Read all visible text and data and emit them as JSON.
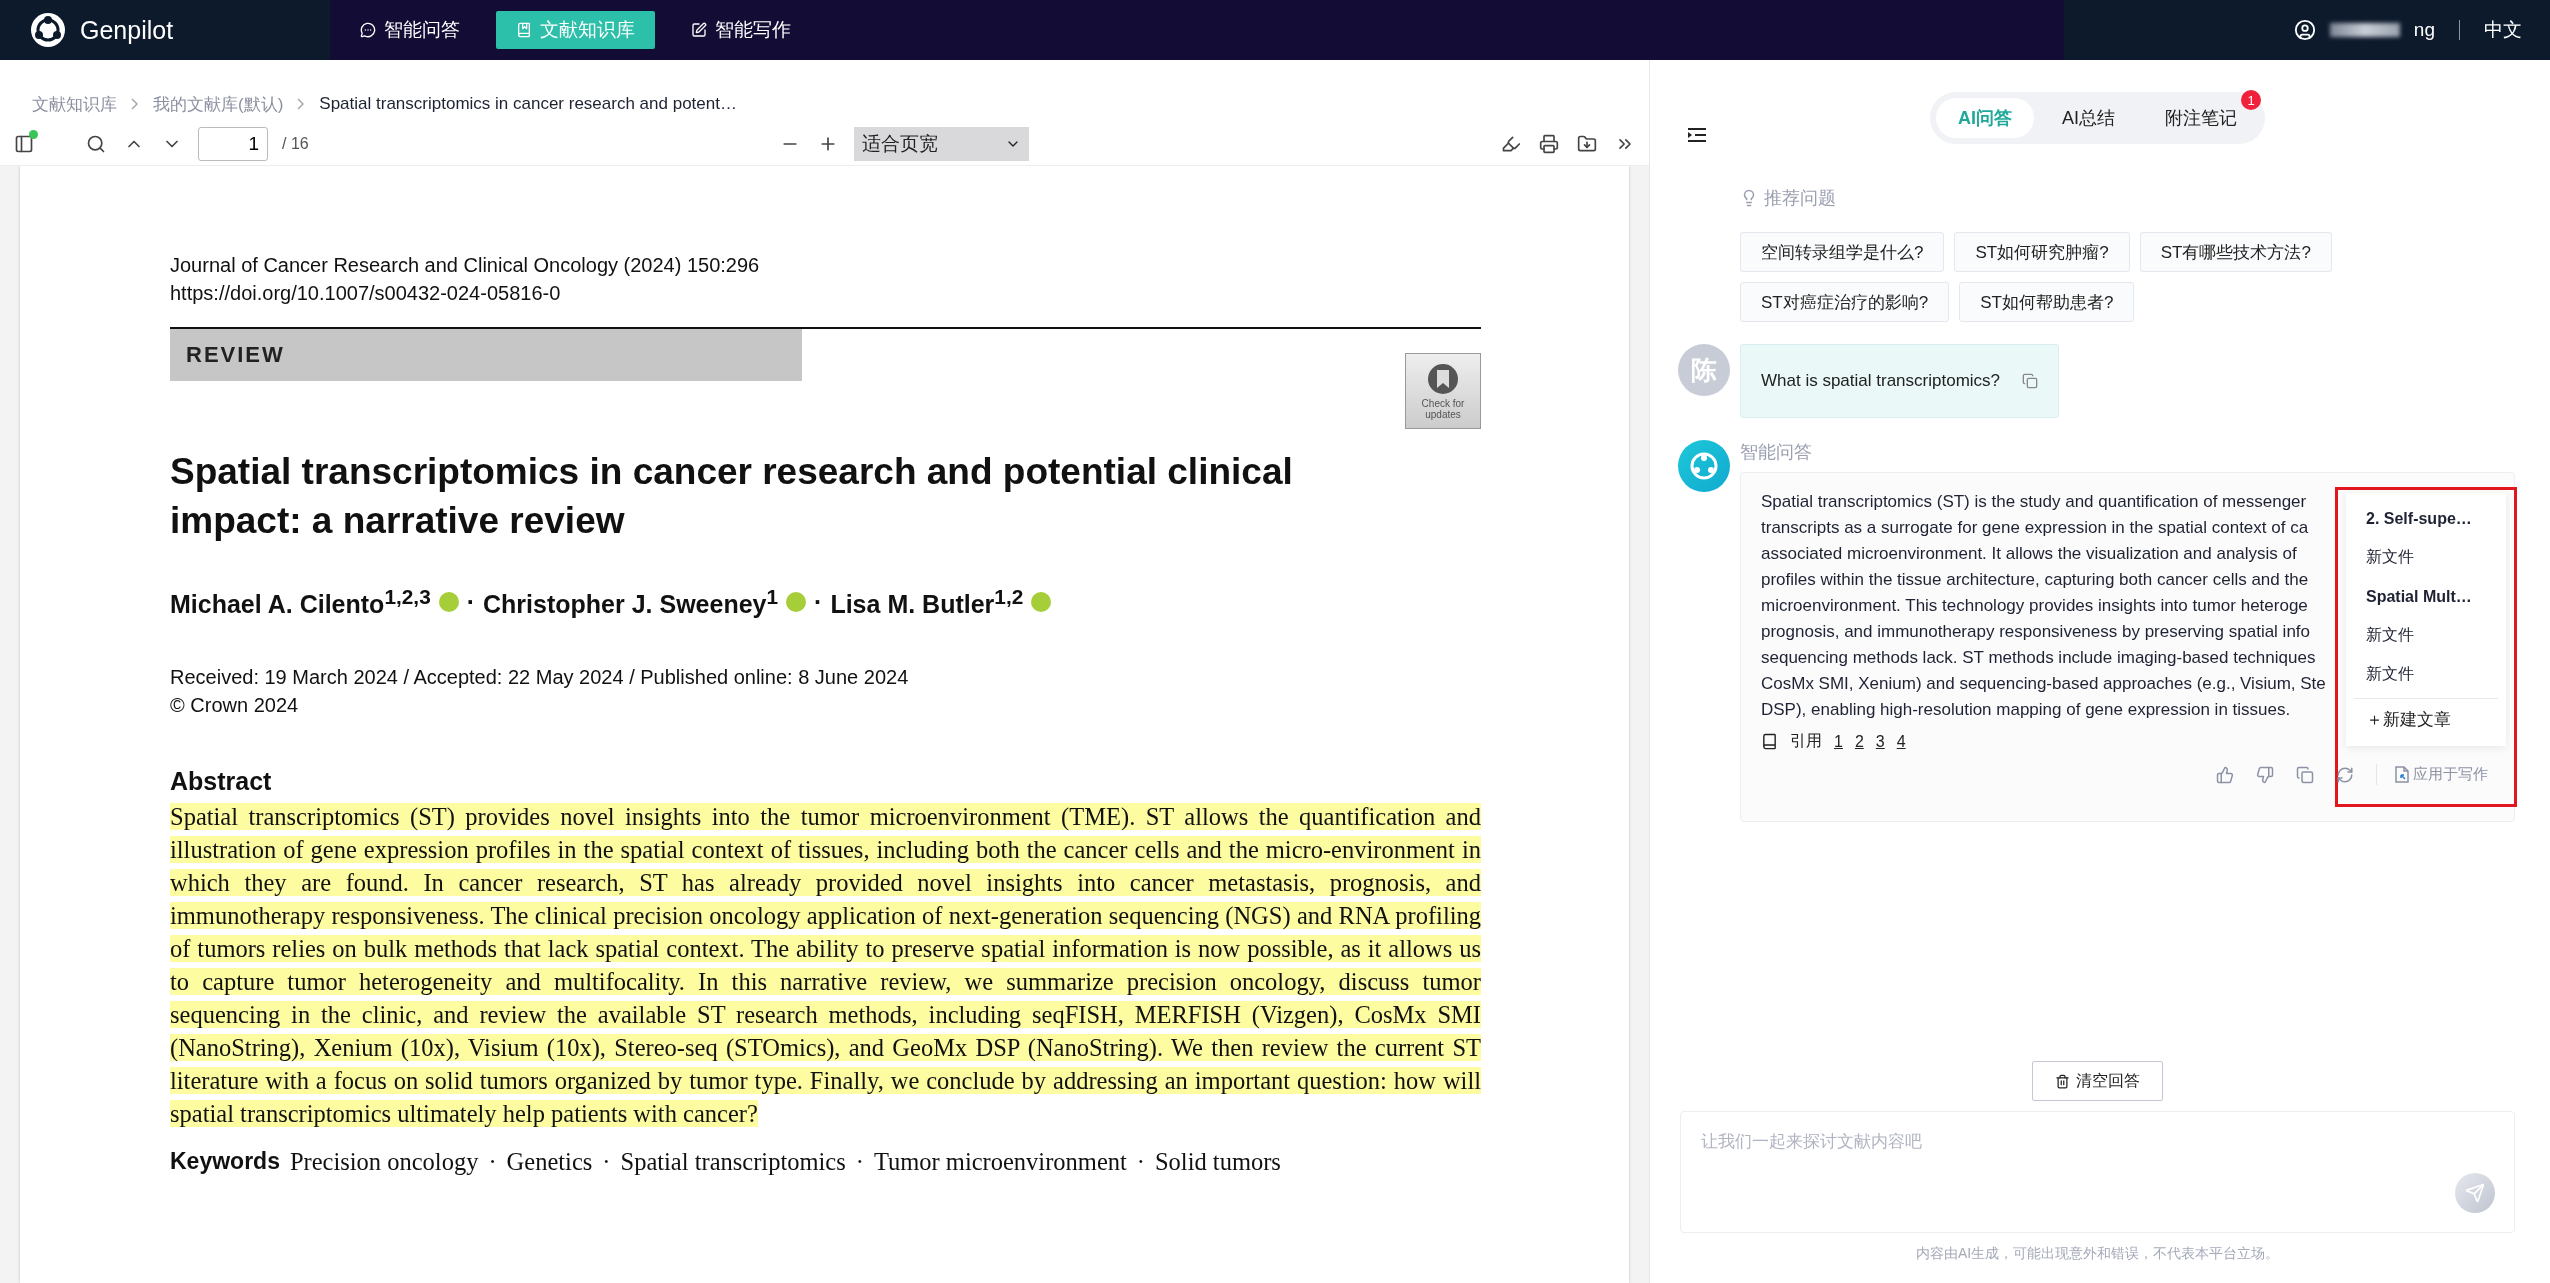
{
  "app": {
    "name": "Genpilot"
  },
  "nav": [
    {
      "label": "智能问答",
      "selected": false,
      "kind": "chat"
    },
    {
      "label": "文献知识库",
      "selected": true,
      "kind": "library"
    },
    {
      "label": "智能写作",
      "selected": false,
      "kind": "write"
    }
  ],
  "user": {
    "name": "ng",
    "language": "中文"
  },
  "breadcrumb": [
    "文献知识库",
    "我的文献库(默认)",
    "Spatial transcriptomics in cancer research and potent…"
  ],
  "viewer": {
    "page": "1",
    "page_count": "/ 16",
    "zoom": "适合页宽"
  },
  "document": {
    "journal": "Journal of Cancer Research and Clinical Oncology (2024) 150:296",
    "doi": "https://doi.org/10.1007/s00432-024-05816-0",
    "article_type": "REVIEW",
    "update_badge": "Check for updates",
    "title": "Spatial transcriptomics in cancer research and potential clinical impact: a narrative review",
    "authors": [
      {
        "name": "Michael A. Cilento",
        "affiliations": "1,2,3"
      },
      {
        "name": "Christopher J. Sweeney",
        "affiliations": "1"
      },
      {
        "name": "Lisa M. Butler",
        "affiliations": "1,2"
      }
    ],
    "author_separator": "·",
    "dates": "Received: 19 March 2024 / Accepted: 22 May 2024 / Published online: 8 June 2024",
    "copyright": "© Crown 2024",
    "abstract_heading": "Abstract",
    "abstract": "Spatial transcriptomics (ST) provides novel insights into the tumor microenvironment (TME). ST allows the quantification and illustration of gene expression profiles in the spatial context of tissues, including both the cancer cells and the micro-environment in which they are found. In cancer research, ST has already provided novel insights into cancer metastasis, prognosis, and immunotherapy responsiveness. The clinical precision oncology application of next-generation sequencing (NGS) and RNA profiling of tumors relies on bulk methods that lack spatial context. The ability to preserve spatial information is now possible, as it allows us to capture tumor heterogeneity and multifocality. In this narrative review, we summarize precision oncology, discuss tumor sequencing in the clinic, and review the available ST research methods, including seqFISH, MERFISH (Vizgen), CosMx SMI (NanoString), Xenium (10x), Visium (10x), Stereo-seq (STOmics), and GeoMx DSP (NanoString). We then review the current ST literature with a focus on solid tumors organized by tumor type. Finally, we conclude by addressing an important question: how will spatial transcriptomics ultimately help patients with cancer?",
    "abstract_highlighted": true,
    "keywords_label": "Keywords",
    "keywords": [
      "Precision oncology",
      "Genetics",
      "Spatial transcriptomics",
      "Tumor microenvironment",
      "Solid tumors"
    ],
    "keyword_separator": "·"
  },
  "panel": {
    "tabs": [
      {
        "label": "AI问答",
        "selected": true
      },
      {
        "label": "AI总结",
        "selected": false
      },
      {
        "label": "附注笔记",
        "selected": false,
        "badge": "1"
      }
    ],
    "suggestions_title": "推荐问题",
    "suggestions": [
      "空间转录组学是什么?",
      "ST如何研究肿瘤?",
      "ST有哪些技术方法?",
      "ST对癌症治疗的影响?",
      "ST如何帮助患者?"
    ],
    "question": {
      "avatar": "陈",
      "text": "What is spatial transcriptomics?"
    },
    "answer": {
      "sender": "智能问答",
      "lines": [
        "Spatial transcriptomics (ST) is the study and quantification of messenger",
        "transcripts as a surrogate for gene expression in the spatial context of ca",
        "associated microenvironment. It allows the visualization and analysis of",
        "profiles within the tissue architecture, capturing both cancer cells and the",
        "microenvironment. This technology provides insights into tumor heteroge",
        "prognosis, and immunotherapy responsiveness by preserving spatial info",
        "sequencing methods lack. ST methods include imaging-based techniques",
        "CosMx SMI, Xenium) and sequencing-based approaches (e.g., Visium, Ste",
        "DSP), enabling high-resolution mapping of gene expression in tissues."
      ],
      "cite_label": "引用",
      "citations": [
        "1",
        "2",
        "3",
        "4"
      ],
      "apply_label": "应用于写作"
    },
    "menu": {
      "items": [
        {
          "label": "2. Self-supe…",
          "bold": true
        },
        {
          "label": "新文件",
          "bold": false
        },
        {
          "label": "Spatial Mult…",
          "bold": true
        },
        {
          "label": "新文件",
          "bold": false
        },
        {
          "label": "新文件",
          "bold": false
        }
      ],
      "new_label": "＋新建文章",
      "outlined": true
    },
    "clear_label": "清空回答",
    "input_placeholder": "让我们一起来探讨文献内容吧",
    "disclaimer": "内容由AI生成，可能出现意外和错误，不代表本平台立场。"
  }
}
